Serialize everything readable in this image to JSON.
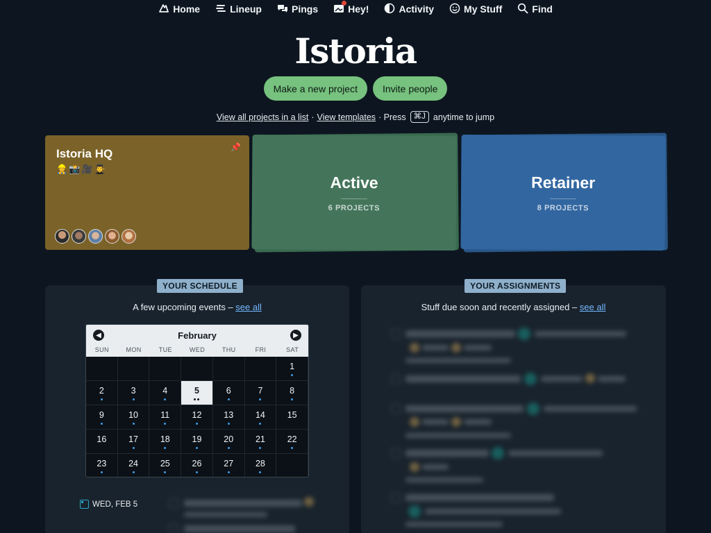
{
  "nav": {
    "items": [
      {
        "label": "Home",
        "icon": "home-icon"
      },
      {
        "label": "Lineup",
        "icon": "lineup-icon"
      },
      {
        "label": "Pings",
        "icon": "pings-icon"
      },
      {
        "label": "Hey!",
        "icon": "hey-icon"
      },
      {
        "label": "Activity",
        "icon": "activity-icon"
      },
      {
        "label": "My Stuff",
        "icon": "smiley-icon"
      },
      {
        "label": "Find",
        "icon": "search-icon"
      }
    ]
  },
  "brand": {
    "logo": "Istoria"
  },
  "actions": {
    "new_project": "Make a new project",
    "invite": "Invite people"
  },
  "links": {
    "view_all": "View all projects in a list",
    "sep1": "·",
    "templates": "View templates",
    "sep2": "· Press",
    "shortcut": "⌘J",
    "suffix": "anytime to jump"
  },
  "cards": {
    "hq": {
      "title": "Istoria HQ",
      "emojis": "👷📸🎥👨‍🎓",
      "pin_icon": "pin-icon"
    },
    "active": {
      "title": "Active",
      "count": "6 PROJECTS"
    },
    "retainer": {
      "title": "Retainer",
      "count": "8 PROJECTS"
    }
  },
  "colors": {
    "background": "#0d1620",
    "hq_card": "#7b6228",
    "active_card": "#3f6f55",
    "retainer_card": "#2e5e96",
    "pill": "#76c27e",
    "link": "#74b7ff"
  },
  "schedule": {
    "badge": "YOUR SCHEDULE",
    "sub_prefix": "A few upcoming events –",
    "see_all": "see all",
    "calendar": {
      "month": "February",
      "dows": [
        "SUN",
        "MON",
        "TUE",
        "WED",
        "THU",
        "FRI",
        "SAT"
      ],
      "days": [
        {
          "d": "",
          "dots": 0
        },
        {
          "d": "",
          "dots": 0
        },
        {
          "d": "",
          "dots": 0
        },
        {
          "d": "",
          "dots": 0
        },
        {
          "d": "",
          "dots": 0
        },
        {
          "d": "",
          "dots": 0
        },
        {
          "d": "1",
          "dots": 1
        },
        {
          "d": "2",
          "dots": 1
        },
        {
          "d": "3",
          "dots": 1
        },
        {
          "d": "4",
          "dots": 1
        },
        {
          "d": "5",
          "dots": 2,
          "today": true
        },
        {
          "d": "6",
          "dots": 1
        },
        {
          "d": "7",
          "dots": 1
        },
        {
          "d": "8",
          "dots": 1
        },
        {
          "d": "9",
          "dots": 1
        },
        {
          "d": "10",
          "dots": 1
        },
        {
          "d": "11",
          "dots": 1
        },
        {
          "d": "12",
          "dots": 1
        },
        {
          "d": "13",
          "dots": 1
        },
        {
          "d": "14",
          "dots": 1
        },
        {
          "d": "15",
          "dots": 0
        },
        {
          "d": "16",
          "dots": 0
        },
        {
          "d": "17",
          "dots": 1
        },
        {
          "d": "18",
          "dots": 1
        },
        {
          "d": "19",
          "dots": 1
        },
        {
          "d": "20",
          "dots": 1
        },
        {
          "d": "21",
          "dots": 1
        },
        {
          "d": "22",
          "dots": 1
        },
        {
          "d": "23",
          "dots": 1
        },
        {
          "d": "24",
          "dots": 1
        },
        {
          "d": "25",
          "dots": 1
        },
        {
          "d": "26",
          "dots": 1
        },
        {
          "d": "27",
          "dots": 1
        },
        {
          "d": "28",
          "dots": 1
        },
        {
          "d": "",
          "dots": 0
        }
      ]
    },
    "date_label": "WED, FEB 5"
  },
  "assignments": {
    "badge": "YOUR ASSIGNMENTS",
    "sub_prefix": "Stuff due soon and recently assigned –",
    "see_all": "see all"
  }
}
